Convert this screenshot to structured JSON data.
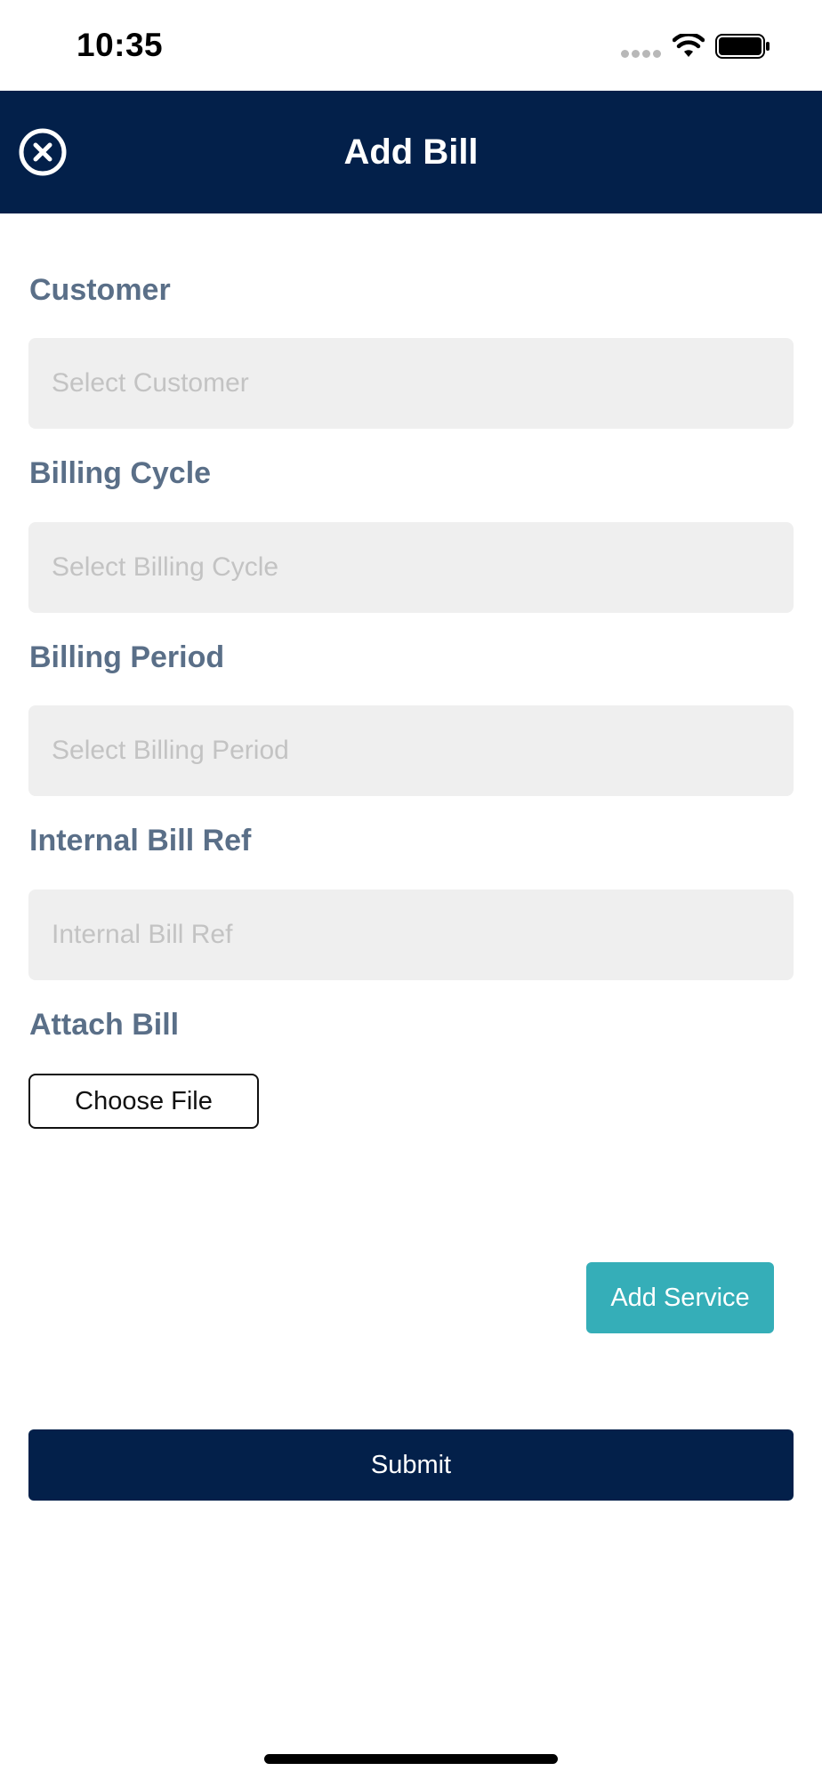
{
  "status_bar": {
    "time": "10:35"
  },
  "header": {
    "title": "Add Bill",
    "close_icon": "close-circle-icon"
  },
  "form": {
    "customer": {
      "label": "Customer",
      "placeholder": "Select Customer"
    },
    "billing_cycle": {
      "label": "Billing Cycle",
      "placeholder": "Select Billing Cycle"
    },
    "billing_period": {
      "label": "Billing Period",
      "placeholder": "Select Billing Period"
    },
    "internal_bill_ref": {
      "label": "Internal Bill Ref",
      "placeholder": "Internal Bill Ref"
    },
    "attach_bill": {
      "label": "Attach Bill",
      "button_label": "Choose File"
    }
  },
  "actions": {
    "add_service_label": "Add Service",
    "submit_label": "Submit"
  },
  "colors": {
    "header": "#03204a",
    "label": "#5a6f88",
    "accent": "#35aeb8",
    "input_bg": "#efefef"
  }
}
